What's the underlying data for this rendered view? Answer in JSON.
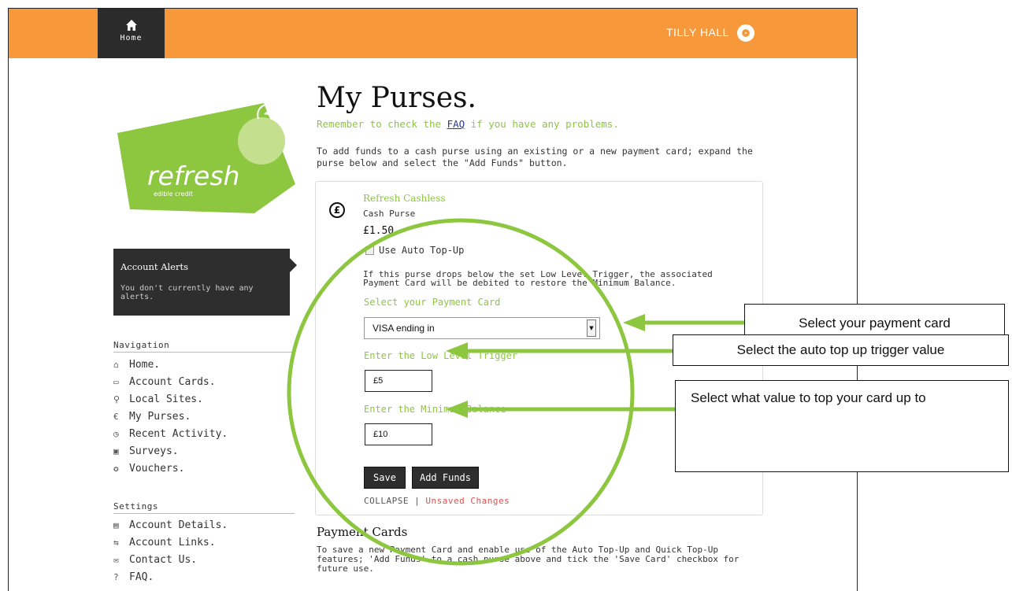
{
  "topbar": {
    "home_label": "Home",
    "user_name": "TILLY HALL"
  },
  "logo": {
    "brand": "refresh",
    "tagline": "edible credit",
    "colors": {
      "card": "#8dc63f",
      "apple": "#c4e08e",
      "text": "#ffffff"
    }
  },
  "alerts": {
    "title": "Account Alerts",
    "message": "You don't currently have any alerts."
  },
  "navigation": {
    "heading": "Navigation",
    "items": [
      {
        "label": "Home.",
        "icon": "home-icon"
      },
      {
        "label": "Account Cards.",
        "icon": "card-icon"
      },
      {
        "label": "Local Sites.",
        "icon": "map-pin-icon"
      },
      {
        "label": "My Purses.",
        "icon": "purse-icon"
      },
      {
        "label": "Recent Activity.",
        "icon": "clock-icon"
      },
      {
        "label": "Surveys.",
        "icon": "clipboard-icon"
      },
      {
        "label": "Vouchers.",
        "icon": "voucher-icon"
      }
    ]
  },
  "settings": {
    "heading": "Settings",
    "items": [
      {
        "label": "Account Details.",
        "icon": "details-icon"
      },
      {
        "label": "Account Links.",
        "icon": "links-icon"
      },
      {
        "label": "Contact Us.",
        "icon": "mail-icon"
      },
      {
        "label": "FAQ.",
        "icon": "help-icon"
      }
    ]
  },
  "main": {
    "title": "My Purses.",
    "faq_prefix": "Remember to check the ",
    "faq_link": "FAQ",
    "faq_suffix": " if you have any problems.",
    "intro": "To add funds to a cash purse using an existing or a new payment card; expand the purse below and select the \"Add Funds\" button."
  },
  "purse": {
    "name": "Refresh Cashless",
    "type": "Cash Purse",
    "balance": "£1.50",
    "auto_topup_label": "Use Auto Top-Up",
    "auto_topup_checked": false,
    "auto_topup_desc": "If this purse drops below the set Low Level Trigger, the associated Payment Card will be debited to restore the Minimum Balance.",
    "payment_card_label": "Select your Payment Card",
    "payment_card_value": "VISA ending in",
    "low_trigger_label": "Enter the Low Level Trigger",
    "low_trigger_value": "£5",
    "min_balance_label": "Enter the Minimum Balance",
    "min_balance_value": "£10",
    "save_label": "Save",
    "add_funds_label": "Add Funds",
    "collapse_label": "COLLAPSE",
    "separator": "|",
    "unsaved_label": "Unsaved Changes"
  },
  "payment_cards": {
    "title": "Payment Cards",
    "text": "To save a new Payment Card and enable use of the Auto Top-Up and Quick Top-Up features; 'Add Funds' to a cash purse above and tick the 'Save Card' checkbox for future use."
  },
  "annotations": {
    "callout_1": "Select your payment card",
    "callout_2": "Select the auto top up trigger value",
    "callout_3": "Select what value to top your card up to",
    "highlight_color": "#8dc63f"
  },
  "colors": {
    "topbar": "#f7993a",
    "accent_green": "#8dc63f",
    "dark": "#2e2e2e",
    "warning": "#d9534f",
    "link": "#2a3a8c"
  }
}
